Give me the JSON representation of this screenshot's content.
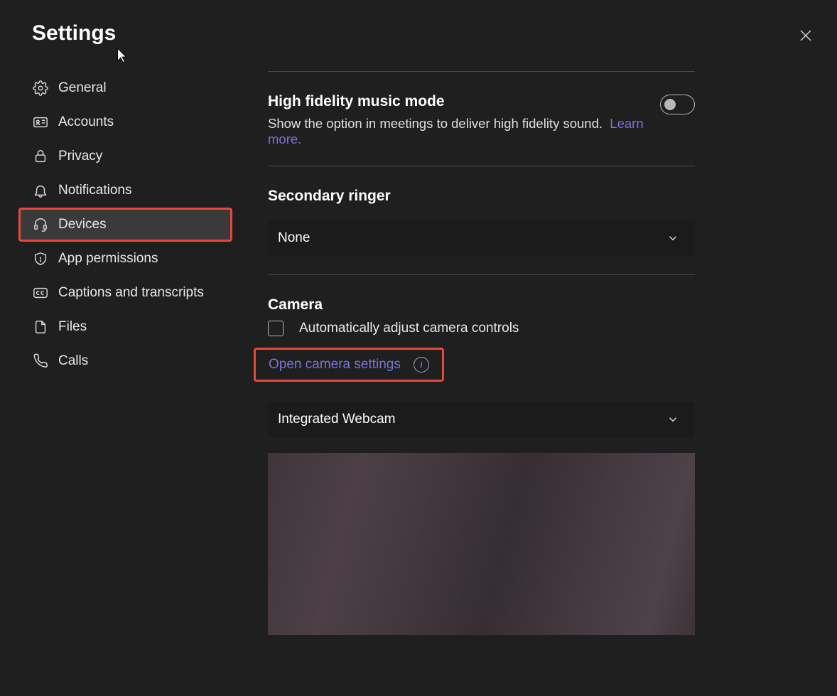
{
  "title": "Settings",
  "close_label": "Close",
  "sidebar": {
    "items": [
      {
        "label": "General",
        "icon": "gear"
      },
      {
        "label": "Accounts",
        "icon": "id-card"
      },
      {
        "label": "Privacy",
        "icon": "lock"
      },
      {
        "label": "Notifications",
        "icon": "bell"
      },
      {
        "label": "Devices",
        "icon": "headset",
        "active": true
      },
      {
        "label": "App permissions",
        "icon": "shield"
      },
      {
        "label": "Captions and transcripts",
        "icon": "cc"
      },
      {
        "label": "Files",
        "icon": "file"
      },
      {
        "label": "Calls",
        "icon": "phone"
      }
    ]
  },
  "main": {
    "hifi": {
      "title": "High fidelity music mode",
      "desc": "Show the option in meetings to deliver high fidelity sound.",
      "learn_more": "Learn more.",
      "toggle_on": false
    },
    "secondary_ringer": {
      "title": "Secondary ringer",
      "value": "None"
    },
    "camera": {
      "title": "Camera",
      "auto_adjust_label": "Automatically adjust camera controls",
      "auto_adjust_checked": false,
      "open_settings_label": "Open camera settings",
      "device_value": "Integrated Webcam"
    }
  }
}
